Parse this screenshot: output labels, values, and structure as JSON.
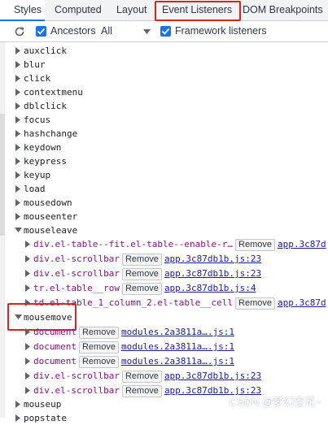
{
  "tabs": [
    {
      "label": "Styles",
      "active": true
    },
    {
      "label": "Computed",
      "active": false
    },
    {
      "label": "Layout",
      "active": false
    },
    {
      "label": "Event Listeners",
      "active": false,
      "highlighted": true
    },
    {
      "label": "DOM Breakpoints",
      "active": false
    }
  ],
  "toolbar": {
    "ancestors_label": "Ancestors",
    "ancestors_checked": true,
    "filter_value": "All",
    "framework_label": "Framework listeners",
    "framework_checked": true
  },
  "events": [
    {
      "name": "auxclick",
      "expanded": false
    },
    {
      "name": "blur",
      "expanded": false
    },
    {
      "name": "click",
      "expanded": false
    },
    {
      "name": "contextmenu",
      "expanded": false
    },
    {
      "name": "dblclick",
      "expanded": false
    },
    {
      "name": "focus",
      "expanded": false
    },
    {
      "name": "hashchange",
      "expanded": false
    },
    {
      "name": "keydown",
      "expanded": false
    },
    {
      "name": "keypress",
      "expanded": false
    },
    {
      "name": "keyup",
      "expanded": false
    },
    {
      "name": "load",
      "expanded": false
    },
    {
      "name": "mousedown",
      "expanded": false
    },
    {
      "name": "mouseenter",
      "expanded": false
    },
    {
      "name": "mouseleave",
      "expanded": true
    },
    {
      "name": "mousemove",
      "expanded": true,
      "highlighted": true
    },
    {
      "name": "mouseup",
      "expanded": false
    },
    {
      "name": "popstate",
      "expanded": false
    }
  ],
  "listeners": {
    "mouseleave": [
      {
        "node": "div.el-table--fit.el-table--enable-r…",
        "remove": "Remove",
        "source": "app.3c87d"
      },
      {
        "node": "div.el-scrollbar",
        "remove": "Remove",
        "source": "app.3c87db1b.js:23"
      },
      {
        "node": "div.el-scrollbar",
        "remove": "Remove",
        "source": "app.3c87db1b.js:23"
      },
      {
        "node": "tr.el-table__row",
        "remove": "Remove",
        "source": "app.3c87db1b.js:4"
      },
      {
        "node": "td.el-table_1_column_2.el-table__cell",
        "remove": "Remove",
        "source": "app.3c87d"
      }
    ],
    "mousemove": [
      {
        "node": "document",
        "remove": "Remove",
        "source": "modules.2a3811a….js:1"
      },
      {
        "node": "document",
        "remove": "Remove",
        "source": "modules.2a3811a….js:1"
      },
      {
        "node": "document",
        "remove": "Remove",
        "source": "modules.2a3811a….js:1"
      },
      {
        "node": "div.el-scrollbar",
        "remove": "Remove",
        "source": "app.3c87db1b.js:23"
      },
      {
        "node": "div.el-scrollbar",
        "remove": "Remove",
        "source": "app.3c87db1b.js:23"
      }
    ]
  },
  "watermark": "CSDN @梦幻空花~",
  "colors": {
    "accent": "#1a73e8",
    "highlight": "#e0201b",
    "node": "#881280",
    "link": "#1a1aa6"
  }
}
